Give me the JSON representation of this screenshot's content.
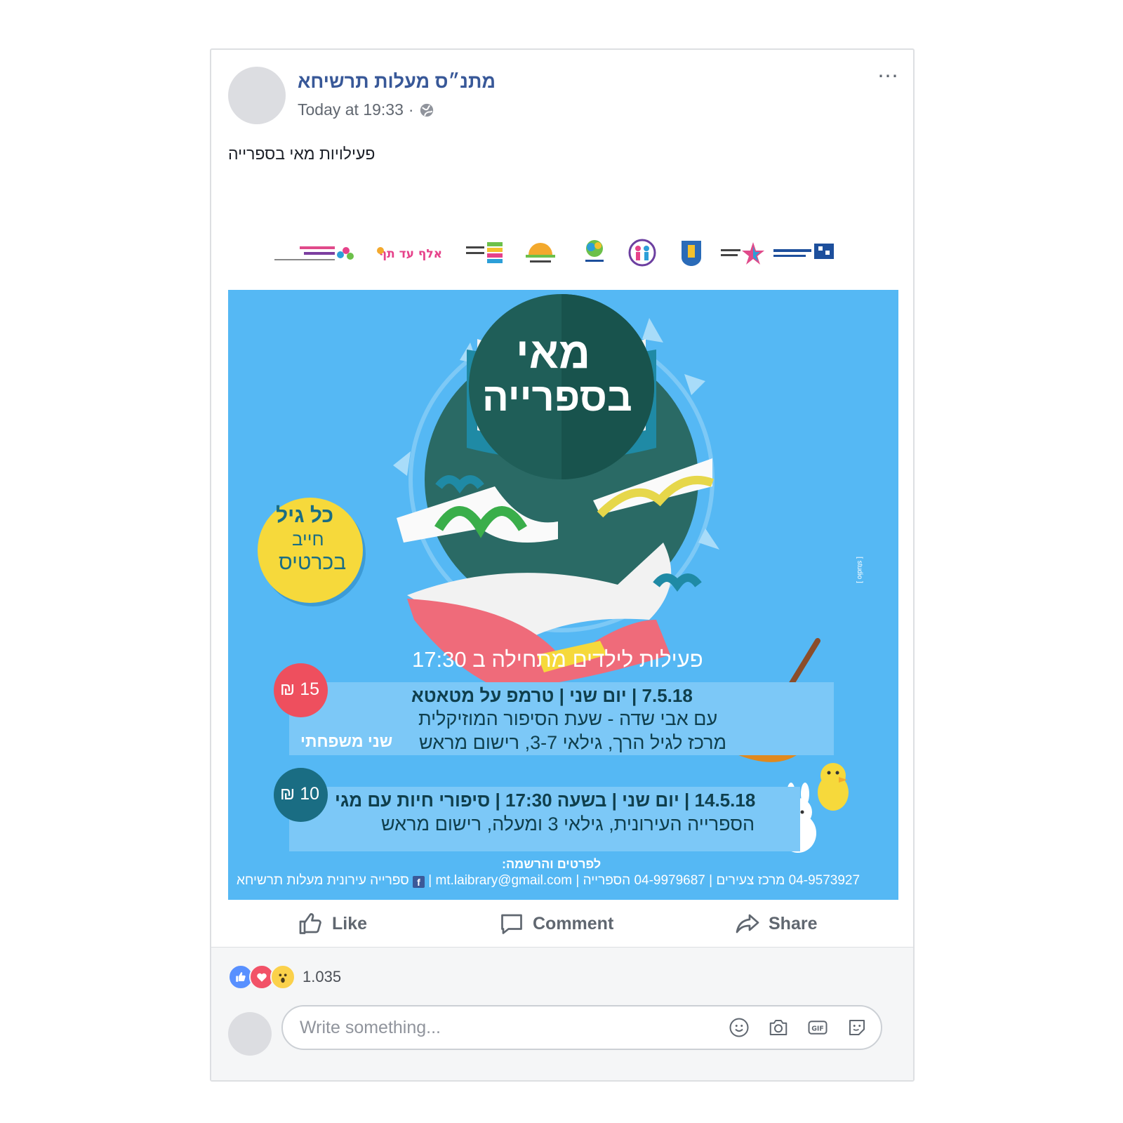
{
  "post": {
    "page_name": "מתנ״ס מעלות תרשיחא",
    "timestamp": "Today at 19:33",
    "separator": "·",
    "text": "פעילויות מאי בספרייה",
    "more_icon": "⋯"
  },
  "poster": {
    "title_line1": "מאי",
    "title_line2": "בספרייה",
    "badge_line1": "כל גיל",
    "badge_line2": "חייב",
    "badge_line3": "בכרטיס",
    "subtitle": "פעילות לילדים מתחילה ב 17:30",
    "event1": {
      "line1": "7.5.18 | יום שני | טרמפ על מטאטא",
      "line2": "עם אבי שדה - שעת הסיפור המוזיקלית",
      "line3": "מרכז לגיל הרך, גילאי 3-7, רישום מראש",
      "tag": "שני משפחתי",
      "price": "15 ₪"
    },
    "event2": {
      "line1": "14.5.18 | יום שני | בשעה 17:30 | סיפורי חיות עם מגי",
      "line2": "הספרייה העירונית, גילאי 3 ומעלה, רישום מראש",
      "price": "10 ₪"
    },
    "details_heading": "לפרטים והרשמה:",
    "contacts": "ספרייה עירונית מעלות תרשיחא",
    "contacts_email": "mt.laibrary@gmail.com",
    "contacts_phones": "04-9573927 מרכז צעירים | 04-9979687 הספרייה",
    "credit": "[ studio ]",
    "logos": [
      "ספרייה עירונית מעלות תרשיחא",
      "משרד התרבות והספורט",
      "עיריית מעלות תרשיחא",
      "אגודת ...",
      "מרכז צעירים",
      "המשרד ...",
      "אלף עד תף",
      "החברה למתנסים"
    ]
  },
  "actions": {
    "like": "Like",
    "comment": "Comment",
    "share": "Share"
  },
  "reactions": {
    "count": "1.035",
    "icons": [
      "like-icon",
      "love-icon",
      "wow-icon"
    ]
  },
  "comment": {
    "placeholder": "Write something..."
  },
  "colors": {
    "link": "#385898",
    "poster_bg": "#55b8f4",
    "badge_yellow": "#f6d93b",
    "price_red": "#ee4f5e",
    "price_teal": "#1a6d83"
  }
}
